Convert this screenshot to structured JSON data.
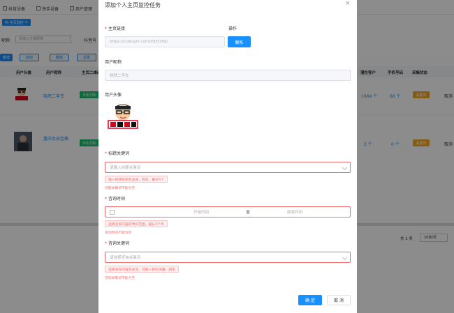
{
  "tabs": [
    "抖音设备",
    "快手设备",
    "商户管理"
  ],
  "active_chip": "抖·主页监控",
  "filter": {
    "label": "昵称",
    "placeholder": "请输入主播昵称",
    "col_label": "抖音号"
  },
  "toolbar": [
    "新增",
    "启动",
    "删除",
    "设置"
  ],
  "table": {
    "headers": [
      "用户头像",
      "用户昵称",
      "主页二维码",
      "潜在客户",
      "手机号码",
      "采集状态"
    ],
    "rows": [
      {
        "nickname": "晓然二手车",
        "qr_btn": "手机扫码",
        "potential": "1664 个",
        "phones": "66 个",
        "status": "采集中",
        "action": "取消"
      },
      {
        "nickname": "重庆女孩金楠",
        "qr_btn": "手机扫码",
        "potential": "2 个",
        "phones": "0 个",
        "status": "采集中",
        "action": "取消"
      }
    ]
  },
  "pagination": {
    "total": "共 2 条",
    "page_size": "10条/页"
  },
  "modal": {
    "title": "添加个人主页监控任务",
    "homepage_label": "主页链接",
    "homepage_value": "https://v.douyin.com/dd3t29S/",
    "operation_label": "操作",
    "parse_button": "解析",
    "nickname_label": "用户昵称",
    "nickname_value": "晓然二手车",
    "avatar_label": "用户头像",
    "title_kw_label": "标题关键词",
    "title_kw_placeholder": "请输入标题关键词",
    "title_kw_tip": "输入视频标题包含词，回车，最多5个",
    "title_kw_error": "标题关键词不能为空",
    "time_label": "咨询时间",
    "start_placeholder": "开始时间",
    "to": "至",
    "end_placeholder": "结束时间",
    "time_tip": "选择咨询内容的时间范围，最长3个月",
    "time_error": "咨询时间不能为空",
    "consult_kw_label": "咨询关键词",
    "consult_kw_placeholder": "请选择咨询关键词",
    "consult_kw_tip": "选择咨询内容包含词，可输入新的词语，回车",
    "consult_kw_error": "咨询关键词不能为空",
    "confirm": "确 定",
    "cancel": "取 消",
    "close": "×"
  },
  "colors": {
    "primary": "#1890ff",
    "error": "#f56c6c",
    "success": "#19be6b",
    "warning": "#f5a623"
  }
}
